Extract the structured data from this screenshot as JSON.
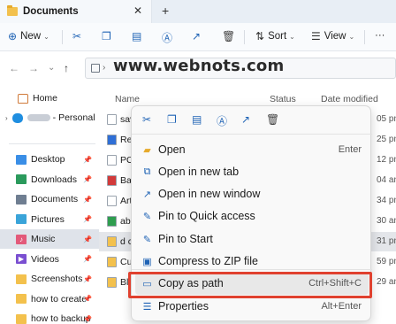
{
  "watermark": "www.webnots.com",
  "tab": {
    "title": "Documents",
    "close": "✕",
    "new_tab": "+"
  },
  "toolbar": {
    "new_label": "New",
    "sort_label": "Sort",
    "view_label": "View",
    "more": "···",
    "caret": "⌄"
  },
  "columns": {
    "name": "Name",
    "status": "Status",
    "date": "Date modified"
  },
  "sidebar": {
    "home": "Home",
    "personal": "- Personal",
    "pinned": [
      {
        "label": "Desktop",
        "icon": "desktop-icon",
        "color": "#3a8ee6"
      },
      {
        "label": "Downloads",
        "icon": "downloads-icon",
        "color": "#2b9a5c"
      },
      {
        "label": "Documents",
        "icon": "documents-icon",
        "color": "#6f7e91"
      },
      {
        "label": "Pictures",
        "icon": "pictures-icon",
        "color": "#3aa4d9"
      },
      {
        "label": "Music",
        "icon": "music-icon",
        "color": "#e35a7a"
      },
      {
        "label": "Videos",
        "icon": "videos-icon",
        "color": "#7a4fd1"
      },
      {
        "label": "Screenshots",
        "icon": "folder-icon",
        "color": "#f3c14d"
      },
      {
        "label": "how to create",
        "icon": "folder-icon",
        "color": "#f3c14d"
      },
      {
        "label": "how to backup",
        "icon": "folder-icon",
        "color": "#f3c14d"
      }
    ]
  },
  "files": [
    {
      "name": "sav",
      "date": "05 pn",
      "color": "#ffffff"
    },
    {
      "name": "Rev",
      "date": "25 pn",
      "color": "#2f6fd6"
    },
    {
      "name": "PO",
      "date": "12 pn",
      "color": "#ffffff"
    },
    {
      "name": "Ba",
      "date": "04 an",
      "color": "#d23a3a"
    },
    {
      "name": "Art",
      "date": "34 pn",
      "color": "#ffffff"
    },
    {
      "name": "abc",
      "date": "30 an",
      "color": "#2f9e4f"
    },
    {
      "name": "d c",
      "date": "31 pn",
      "color": "#f3c14d"
    },
    {
      "name": "Cu",
      "date": "59 pn",
      "color": "#f3c14d"
    },
    {
      "name": "Bl",
      "date": "29 an",
      "color": "#f3c14d"
    }
  ],
  "context_menu": {
    "items": [
      {
        "label": "Open",
        "shortcut": "Enter",
        "icon": "folder-open-icon"
      },
      {
        "label": "Open in new tab",
        "shortcut": "",
        "icon": "new-tab-icon"
      },
      {
        "label": "Open in new window",
        "shortcut": "",
        "icon": "new-window-icon"
      },
      {
        "label": "Pin to Quick access",
        "shortcut": "",
        "icon": "pin-icon"
      },
      {
        "label": "Pin to Start",
        "shortcut": "",
        "icon": "pin-icon"
      },
      {
        "label": "Compress to ZIP file",
        "shortcut": "",
        "icon": "zip-icon"
      },
      {
        "label": "Copy as path",
        "shortcut": "Ctrl+Shift+C",
        "icon": "copy-path-icon"
      },
      {
        "label": "Properties",
        "shortcut": "Alt+Enter",
        "icon": "properties-icon"
      }
    ]
  },
  "colors": {
    "accent": "#1f63b5",
    "highlight_border": "#e0412f"
  }
}
